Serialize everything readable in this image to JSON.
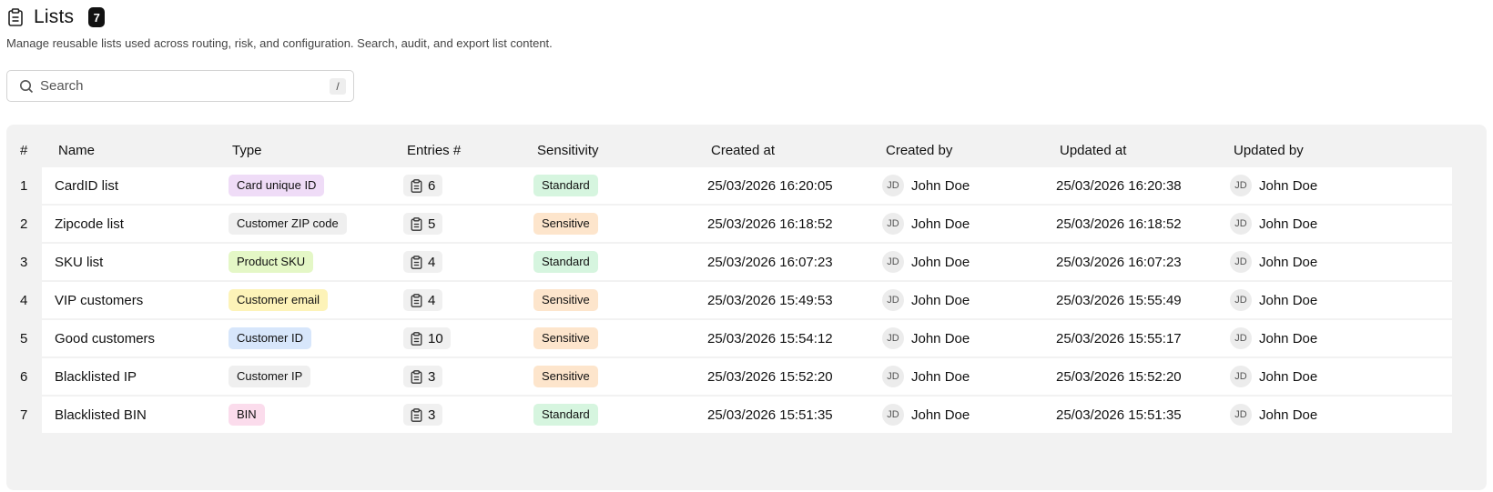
{
  "header": {
    "title": "Lists",
    "count": "7",
    "subtitle": "Manage reusable lists used across routing, risk, and configuration. Search, audit, and export list content."
  },
  "search": {
    "placeholder": "Search",
    "shortcut": "/"
  },
  "table": {
    "columns": [
      "#",
      "Name",
      "Type",
      "Entries #",
      "Sensitivity",
      "Created at",
      "Created by",
      "Updated at",
      "Updated by"
    ],
    "rows": [
      {
        "num": "1",
        "name": "CardID list",
        "type": "Card unique ID",
        "type_bg": "#efdcf7",
        "entries": "6",
        "sensitivity": "Standard",
        "sens_bg": "#d6f5df",
        "created_at": "25/03/2026 16:20:05",
        "created_by": "John Doe",
        "created_initials": "JD",
        "updated_at": "25/03/2026 16:20:38",
        "updated_by": "John Doe",
        "updated_initials": "JD"
      },
      {
        "num": "2",
        "name": "Zipcode list",
        "type": "Customer ZIP code",
        "type_bg": "#efefef",
        "entries": "5",
        "sensitivity": "Sensitive",
        "sens_bg": "#fde5cc",
        "created_at": "25/03/2026 16:18:52",
        "created_by": "John Doe",
        "created_initials": "JD",
        "updated_at": "25/03/2026 16:18:52",
        "updated_by": "John Doe",
        "updated_initials": "JD"
      },
      {
        "num": "3",
        "name": "SKU list",
        "type": "Product SKU",
        "type_bg": "#e4f7c6",
        "entries": "4",
        "sensitivity": "Standard",
        "sens_bg": "#d6f5df",
        "created_at": "25/03/2026 16:07:23",
        "created_by": "John Doe",
        "created_initials": "JD",
        "updated_at": "25/03/2026 16:07:23",
        "updated_by": "John Doe",
        "updated_initials": "JD"
      },
      {
        "num": "4",
        "name": "VIP customers",
        "type": "Customer email",
        "type_bg": "#fdf3b8",
        "entries": "4",
        "sensitivity": "Sensitive",
        "sens_bg": "#fde5cc",
        "created_at": "25/03/2026 15:49:53",
        "created_by": "John Doe",
        "created_initials": "JD",
        "updated_at": "25/03/2026 15:55:49",
        "updated_by": "John Doe",
        "updated_initials": "JD"
      },
      {
        "num": "5",
        "name": "Good customers",
        "type": "Customer ID",
        "type_bg": "#d7e6fb",
        "entries": "10",
        "sensitivity": "Sensitive",
        "sens_bg": "#fde5cc",
        "created_at": "25/03/2026 15:54:12",
        "created_by": "John Doe",
        "created_initials": "JD",
        "updated_at": "25/03/2026 15:55:17",
        "updated_by": "John Doe",
        "updated_initials": "JD"
      },
      {
        "num": "6",
        "name": "Blacklisted IP",
        "type": "Customer IP",
        "type_bg": "#efefef",
        "entries": "3",
        "sensitivity": "Sensitive",
        "sens_bg": "#fde5cc",
        "created_at": "25/03/2026 15:52:20",
        "created_by": "John Doe",
        "created_initials": "JD",
        "updated_at": "25/03/2026 15:52:20",
        "updated_by": "John Doe",
        "updated_initials": "JD"
      },
      {
        "num": "7",
        "name": "Blacklisted BIN",
        "type": "BIN",
        "type_bg": "#fbdcec",
        "entries": "3",
        "sensitivity": "Standard",
        "sens_bg": "#d6f5df",
        "created_at": "25/03/2026 15:51:35",
        "created_by": "John Doe",
        "created_initials": "JD",
        "updated_at": "25/03/2026 15:51:35",
        "updated_by": "John Doe",
        "updated_initials": "JD"
      }
    ]
  },
  "icons": {
    "title": "clipboard-list-icon",
    "search": "search-icon",
    "entries": "clipboard-list-icon"
  },
  "colors": {
    "badge": "#111111",
    "table_bg": "#f2f2f2",
    "row_bg": "#ffffff",
    "standard": "#d6f5df",
    "sensitive": "#fde5cc"
  }
}
